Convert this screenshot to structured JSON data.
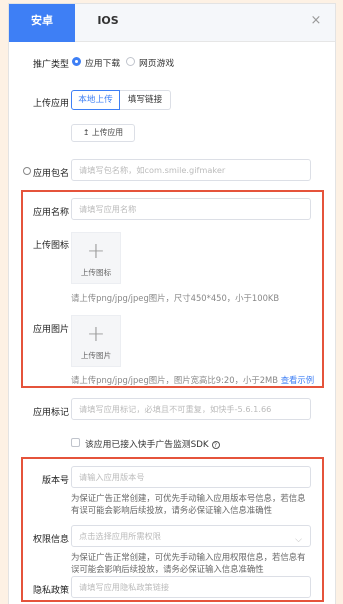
{
  "tabs": {
    "android": "安卓",
    "ios": "IOS"
  },
  "close": "×",
  "promo_type": {
    "label": "推广类型",
    "options": [
      "应用下载",
      "网页游戏"
    ]
  },
  "upload_app": {
    "label": "上传应用",
    "segments": [
      "本地上传",
      "填写链接"
    ],
    "button": "上传应用",
    "upload_icon": "↥"
  },
  "package": {
    "label": "应用包名",
    "placeholder": "请填写包名称，如com.smile.gifmaker"
  },
  "app_name": {
    "label": "应用名称",
    "placeholder": "请填写应用名称"
  },
  "icon_upload": {
    "label": "上传图标",
    "box_label": "上传图标",
    "hint": "请上传png/jpg/jpeg图片，尺寸450*450，小于100KB"
  },
  "app_images": {
    "label": "应用图片",
    "box_label": "上传图片",
    "hint_prefix": "请上传png/jpg/jpeg图片，图片宽高比9:20，小于2MB ",
    "hint_link": "查看示例"
  },
  "app_mark": {
    "label": "应用标记",
    "placeholder": "请填写应用标记，必填且不可重复，如快手-5.6.1.66"
  },
  "sdk_check": {
    "label": "该应用已接入快手广告监测SDK",
    "help": "?"
  },
  "version": {
    "label": "版本号",
    "placeholder": "请输入应用版本号",
    "hint": "为保证广告正常创建，可优先手动输入应用版本号信息，若信息有误可能会影响后续投放，请务必保证输入信息准确性"
  },
  "permissions": {
    "label": "权限信息",
    "placeholder": "点击选择应用所需权限",
    "hint": "为保证广告正常创建，可优先手动输入应用权限信息，若信息有误可能会影响后续投放，请务必保证输入信息准确性"
  },
  "privacy": {
    "label": "隐私政策",
    "placeholder": "请填写应用隐私政策链接"
  },
  "colors": {
    "accent": "#3e7ff5",
    "highlight": "#e5533b"
  }
}
